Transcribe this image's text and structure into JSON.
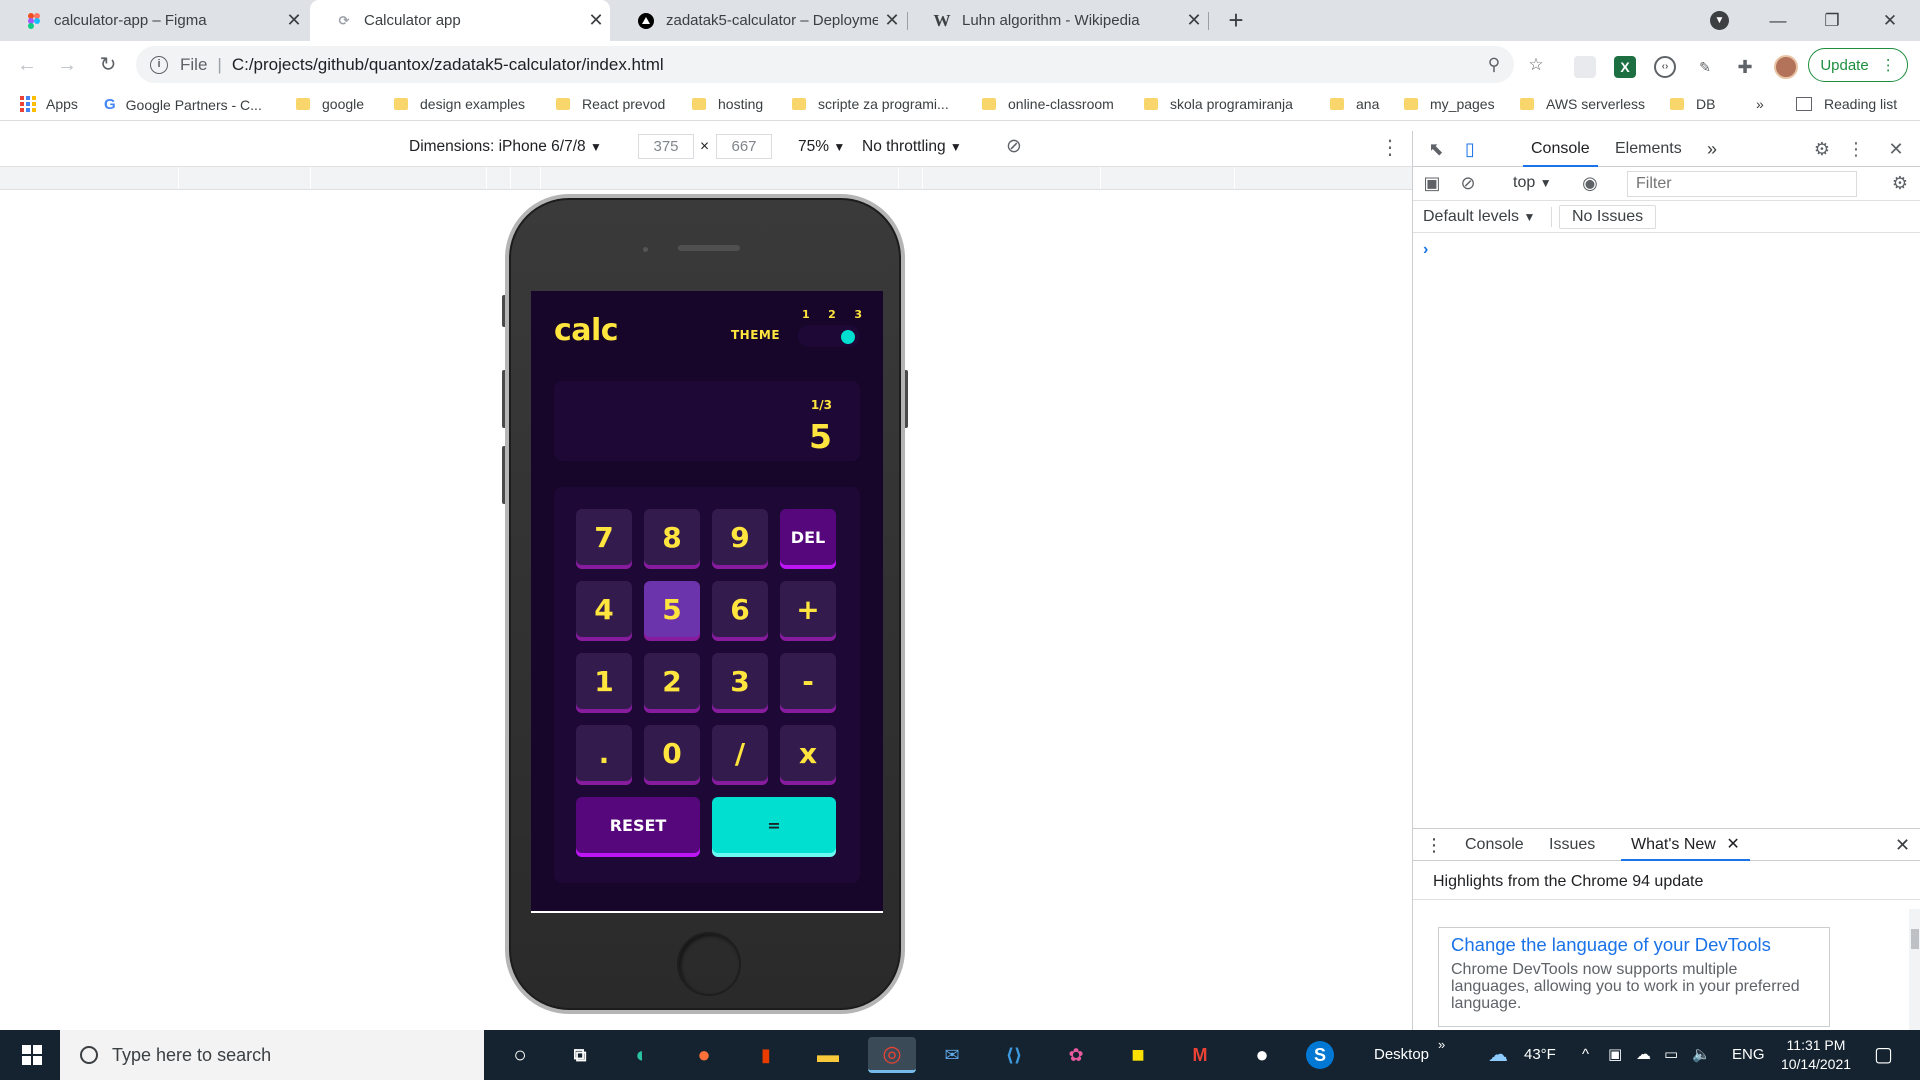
{
  "browser": {
    "tabs": [
      {
        "title": "calculator-app – Figma",
        "icon": "figma-icon"
      },
      {
        "title": "Calculator app",
        "icon": "page-loading-icon"
      },
      {
        "title": "zadatak5-calculator – Deployment",
        "icon": "vercel-icon"
      },
      {
        "title": "Luhn algorithm - Wikipedia",
        "icon": "wikipedia-icon"
      }
    ],
    "omnibox": {
      "scheme_label": "File",
      "url": "C:/projects/github/quantox/zadatak5-calculator/index.html"
    },
    "update_label": "Update",
    "bookmarks": [
      {
        "label": "Apps",
        "type": "apps"
      },
      {
        "label": "Google Partners - C...",
        "type": "google"
      },
      {
        "label": "google",
        "type": "folder"
      },
      {
        "label": "design examples",
        "type": "folder"
      },
      {
        "label": "React prevod",
        "type": "folder"
      },
      {
        "label": "hosting",
        "type": "folder"
      },
      {
        "label": "scripte za programi...",
        "type": "folder"
      },
      {
        "label": "online-classroom",
        "type": "folder"
      },
      {
        "label": "skola programiranja",
        "type": "folder"
      },
      {
        "label": "ana",
        "type": "folder"
      },
      {
        "label": "my_pages",
        "type": "folder"
      },
      {
        "label": "AWS serverless",
        "type": "folder"
      },
      {
        "label": "DB",
        "type": "folder"
      }
    ],
    "bookmarks_overflow": "»",
    "reading_list": "Reading list"
  },
  "device_toolbar": {
    "dimensions_label": "Dimensions: iPhone 6/7/8",
    "width": "375",
    "times": "×",
    "height": "667",
    "zoom": "75%",
    "throttling": "No throttling"
  },
  "calculator": {
    "logo": "calc",
    "theme_label": "THEME",
    "theme_numbers": [
      "1",
      "2",
      "3"
    ],
    "theme_selected": 3,
    "display_sub": "1/3",
    "display_main": "5",
    "keys": [
      "7",
      "8",
      "9",
      "DEL",
      "4",
      "5",
      "6",
      "+",
      "1",
      "2",
      "3",
      "-",
      ".",
      "0",
      "/",
      "x"
    ],
    "reset_label": "RESET",
    "equals_label": "=",
    "colors": {
      "screen_bg": "#17062a",
      "panel_bg": "#1e0836",
      "key": "#331c4d",
      "text": "#ffe53d",
      "accent": "#00dfd0",
      "special": "#56077c"
    }
  },
  "devtools": {
    "tabs": [
      "Console",
      "Elements"
    ],
    "more": "»",
    "context": "top",
    "filter_placeholder": "Filter",
    "levels": "Default levels",
    "issues": "No Issues",
    "prompt": "›",
    "drawer": {
      "tabs": [
        "Console",
        "Issues",
        "What's New"
      ],
      "heading": "Highlights from the Chrome 94 update",
      "card_title": "Change the language of your DevTools",
      "card_body": "Chrome DevTools now supports multiple languages, allowing you to work in your preferred language."
    }
  },
  "taskbar": {
    "search_placeholder": "Type here to search",
    "desktop_label": "Desktop",
    "weather": "43°F",
    "language": "ENG",
    "time": "11:31 PM",
    "date": "10/14/2021"
  }
}
